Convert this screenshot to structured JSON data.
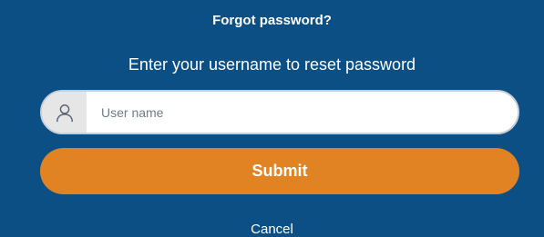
{
  "header": {
    "title": "Forgot password?",
    "subtitle": "Enter your username to reset password"
  },
  "form": {
    "username": {
      "icon": "user-icon",
      "value": "",
      "placeholder": "User name"
    },
    "submit_label": "Submit",
    "cancel_label": "Cancel"
  },
  "colors": {
    "background": "#0b4f85",
    "submit_button": "#e28323",
    "input_icon_bg": "#e6e6e6"
  }
}
